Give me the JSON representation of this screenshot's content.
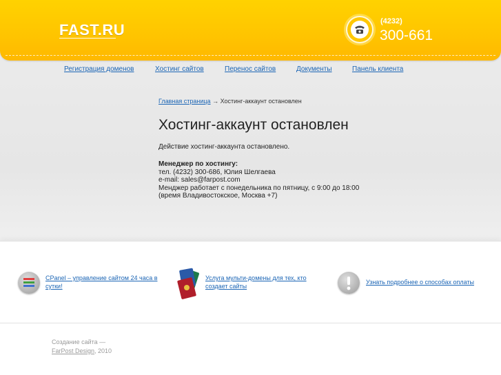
{
  "header": {
    "logo": "FAST.RU",
    "phone_code": "(4232)",
    "phone_number": "300-661"
  },
  "nav": {
    "items": [
      {
        "label": "Регистрация доменов"
      },
      {
        "label": "Хостинг сайтов"
      },
      {
        "label": "Перенос сайтов"
      },
      {
        "label": "Документы"
      },
      {
        "label": "Панель клиента"
      }
    ]
  },
  "breadcrumb": {
    "home_label": "Главная страница",
    "separator": "→",
    "current": "Хостинг-аккаунт остановлен"
  },
  "main": {
    "title": "Хостинг-аккаунт остановлен",
    "status_text": "Действие хостинг-аккаунта остановлено.",
    "manager": {
      "title": "Менеджер по хостингу:",
      "phone_line": "тел. (4232) 300-686, Юлия Шелгаева",
      "email_line": "e-mail: sales@farpost.com",
      "hours_line": "Менджер работает с понедельника по пятницу, с 9:00 до 18:00",
      "tz_line": "(время Владивостокское, Москва +7)"
    }
  },
  "promos": [
    {
      "line1": "CPanel – управление сайтом 24 часа в",
      "line2": "сутки!",
      "icon": "cpanel-icon"
    },
    {
      "line1": "Услуга мульти-домены для тех, кто",
      "line2": "создает сайты",
      "icon": "multi-domain-icon"
    },
    {
      "line1": "Узнать подробнее о способах оплаты",
      "line2": "",
      "icon": "info-icon"
    }
  ],
  "footer": {
    "line1": "Создание сайта —",
    "link": "FarPost Design",
    "year": ", 2010"
  },
  "colors": {
    "header_yellow": "#ffc400",
    "link_blue": "#1b65b5",
    "background_gray": "#ececec"
  }
}
